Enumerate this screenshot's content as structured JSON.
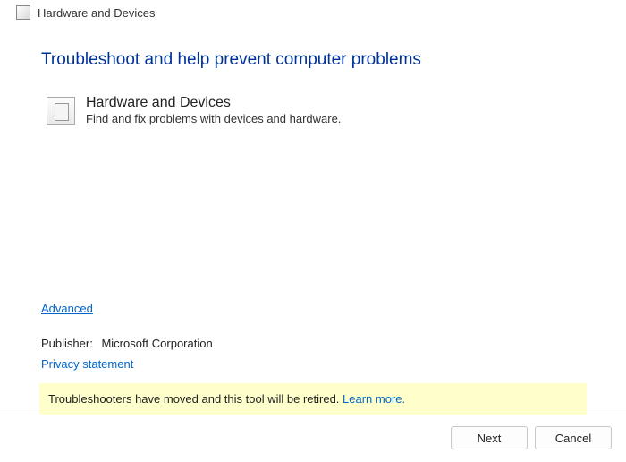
{
  "titlebar": {
    "title": "Hardware and Devices"
  },
  "heading": "Troubleshoot and help prevent computer problems",
  "item": {
    "title": "Hardware and Devices",
    "desc": "Find and fix problems with devices and hardware."
  },
  "links": {
    "advanced": "Advanced",
    "privacy": "Privacy statement",
    "learn_more": "Learn more."
  },
  "publisher": {
    "label": "Publisher:",
    "value": "Microsoft Corporation"
  },
  "notice": {
    "text": "Troubleshooters have moved and this tool will be retired. "
  },
  "buttons": {
    "next": "Next",
    "cancel": "Cancel"
  }
}
